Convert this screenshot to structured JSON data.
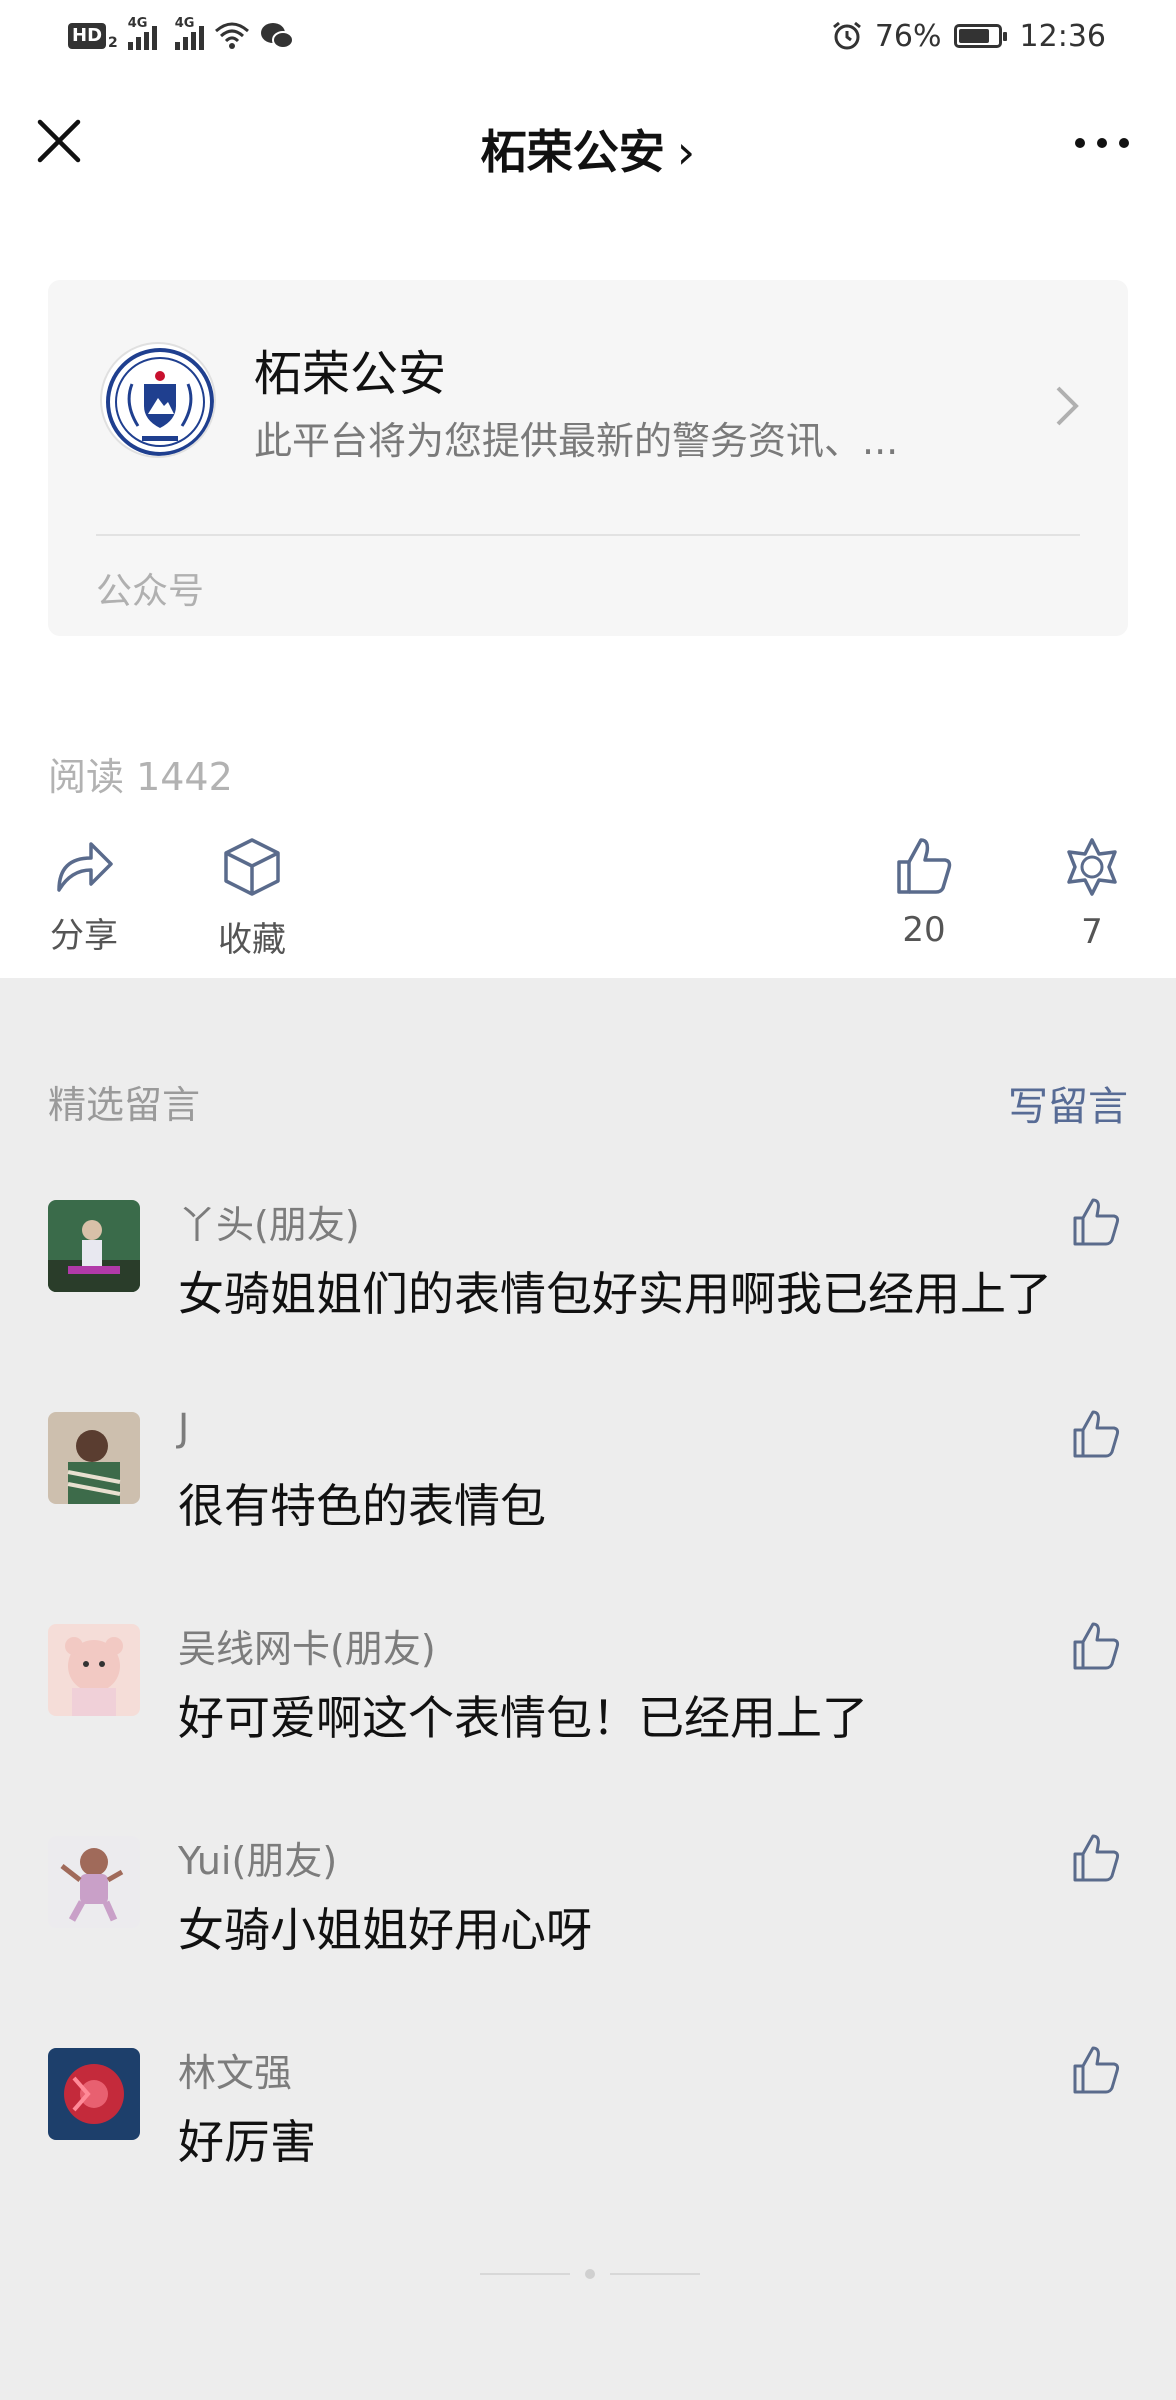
{
  "status_bar": {
    "hd_label": "HD",
    "hd_sub": "2",
    "network1": "4G",
    "network2": "4G",
    "battery_percent": "76%",
    "battery_level": 0.76,
    "time": "12:36"
  },
  "header": {
    "title": "柘荣公安",
    "title_chevron": "›"
  },
  "account": {
    "name": "柘荣公安",
    "description": "此平台将为您提供最新的警务资讯、...",
    "type_label": "公众号"
  },
  "article": {
    "read_text": "阅读 1442"
  },
  "actions": {
    "share_label": "分享",
    "favorite_label": "收藏",
    "like_count": "20",
    "wow_count": "7"
  },
  "comments_section": {
    "title": "精选留言",
    "write_label": "写留言",
    "items": [
      {
        "nickname": "丫头(朋友)",
        "text": "女骑姐姐们的表情包好实用啊我已经用上了",
        "avatar_color": "#3a6b4a"
      },
      {
        "nickname": "J",
        "text": "很有特色的表情包",
        "avatar_color": "#b9a48a"
      },
      {
        "nickname": "吴线网卡(朋友)",
        "text": "好可爱啊这个表情包！已经用上了",
        "avatar_color": "#f2c9c3"
      },
      {
        "nickname": "Yui(朋友)",
        "text": "女骑小姐姐好用心呀",
        "avatar_color": "#e9e3ea"
      },
      {
        "nickname": "林文强",
        "text": "好厉害",
        "avatar_color": "#c42a3b"
      }
    ]
  },
  "colors": {
    "link_blue": "#576b95",
    "page_bg": "#ededed",
    "icon_gray": "#5a6b8c"
  }
}
